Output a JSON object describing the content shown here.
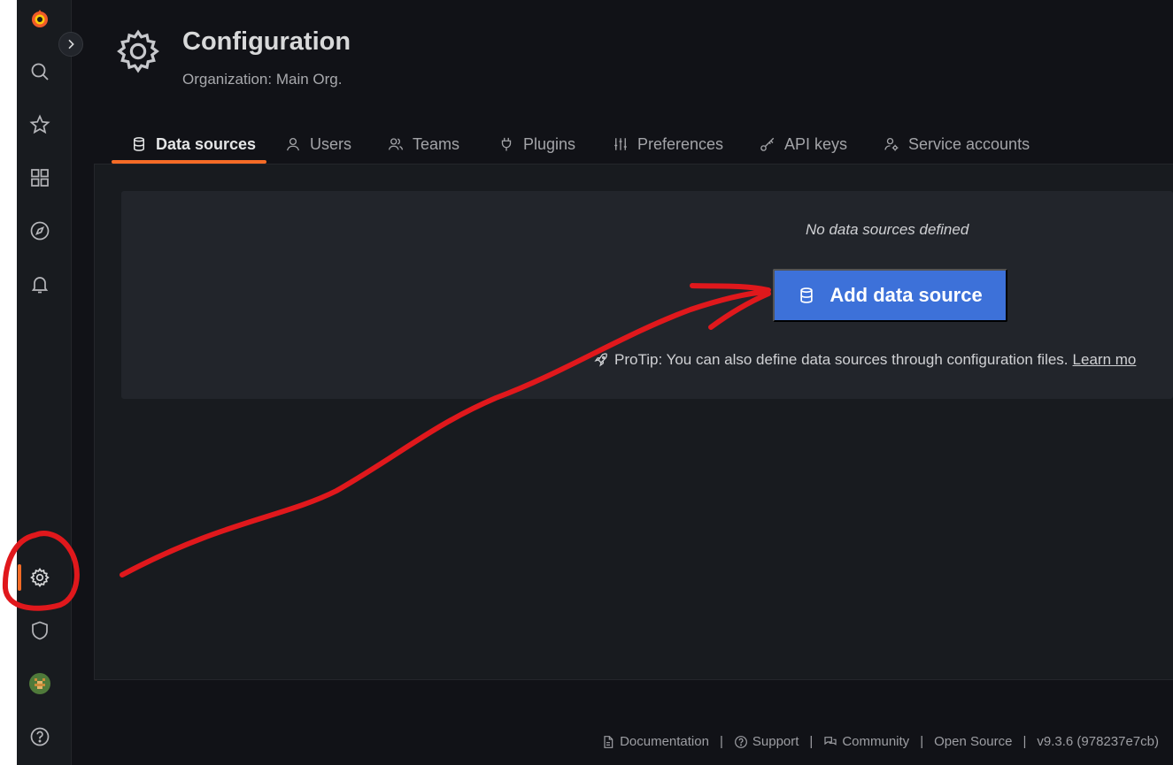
{
  "header": {
    "title": "Configuration",
    "subtitle": "Organization: Main Org.",
    "icon": "gear-icon"
  },
  "tabs": [
    {
      "label": "Data sources",
      "icon": "database-icon",
      "active": true
    },
    {
      "label": "Users",
      "icon": "user-icon",
      "active": false
    },
    {
      "label": "Teams",
      "icon": "users-icon",
      "active": false
    },
    {
      "label": "Plugins",
      "icon": "plug-icon",
      "active": false
    },
    {
      "label": "Preferences",
      "icon": "sliders-icon",
      "active": false
    },
    {
      "label": "API keys",
      "icon": "key-icon",
      "active": false
    },
    {
      "label": "Service accounts",
      "icon": "user-cog-icon",
      "active": false
    }
  ],
  "sidebar": {
    "items": [
      {
        "name": "grafana-logo-icon"
      },
      {
        "name": "search-icon"
      },
      {
        "name": "star-icon"
      },
      {
        "name": "dashboards-icon"
      },
      {
        "name": "explore-compass-icon"
      },
      {
        "name": "alerting-bell-icon"
      },
      {
        "name": "configuration-gear-icon",
        "active": true
      },
      {
        "name": "server-admin-shield-icon"
      },
      {
        "name": "user-avatar"
      },
      {
        "name": "help-icon"
      }
    ]
  },
  "empty_state": {
    "message": "No data sources defined",
    "button_label": "Add data source",
    "protip_text": "ProTip: You can also define data sources through configuration files.",
    "protip_link": "Learn mo"
  },
  "footer": {
    "documentation": "Documentation",
    "support": "Support",
    "community": "Community",
    "open_source": "Open Source",
    "version": "v9.3.6 (978237e7cb)",
    "separator": "|"
  },
  "colors": {
    "accent": "#f46b26",
    "primary_button": "#3d71d9",
    "annotation": "#e0181c"
  }
}
